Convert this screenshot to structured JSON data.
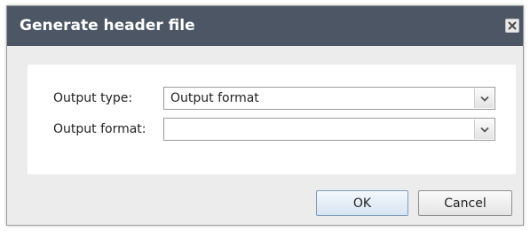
{
  "dialog": {
    "title": "Generate header file",
    "close_icon": "close-icon"
  },
  "form": {
    "output_type": {
      "label": "Output type:",
      "value": "Output format"
    },
    "output_format": {
      "label": "Output format:",
      "value": ""
    }
  },
  "buttons": {
    "ok_label": "OK",
    "cancel_label": "Cancel"
  },
  "colors": {
    "titlebar": "#4d5665",
    "dialog_background": "#ececec",
    "panel_background": "#ffffff"
  }
}
